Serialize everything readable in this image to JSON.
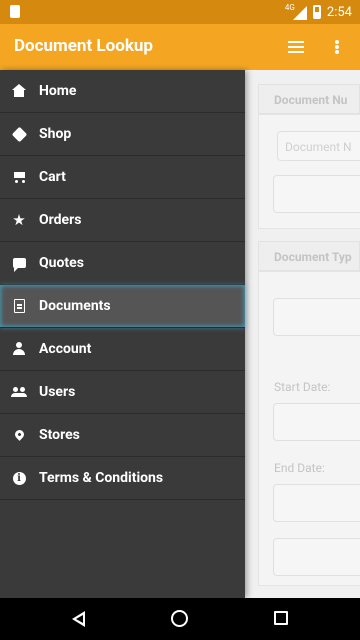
{
  "status_bar": {
    "time": "2:54",
    "network": "4G"
  },
  "app_bar": {
    "title": "Document Lookup"
  },
  "drawer": {
    "items": [
      {
        "label": "Home",
        "icon": "home-icon"
      },
      {
        "label": "Shop",
        "icon": "tag-icon"
      },
      {
        "label": "Cart",
        "icon": "cart-icon"
      },
      {
        "label": "Orders",
        "icon": "star-icon"
      },
      {
        "label": "Quotes",
        "icon": "chat-bubble-icon"
      },
      {
        "label": "Documents",
        "icon": "document-icon",
        "active": true
      },
      {
        "label": "Account",
        "icon": "person-icon"
      },
      {
        "label": "Users",
        "icon": "users-icon"
      },
      {
        "label": "Stores",
        "icon": "location-pin-icon"
      },
      {
        "label": "Terms & Conditions",
        "icon": "info-icon"
      }
    ]
  },
  "form": {
    "document_number_header": "Document Nu",
    "document_number_placeholder": "Document N",
    "document_type_header": "Document Typ",
    "start_date_label": "Start Date:",
    "end_date_label": "End Date:"
  },
  "colors": {
    "app_bar": "#f4a623",
    "status_bar": "#d58a0f",
    "drawer": "#3a3a3a",
    "active_item": "#555555",
    "active_glow": "#3db5e0"
  }
}
